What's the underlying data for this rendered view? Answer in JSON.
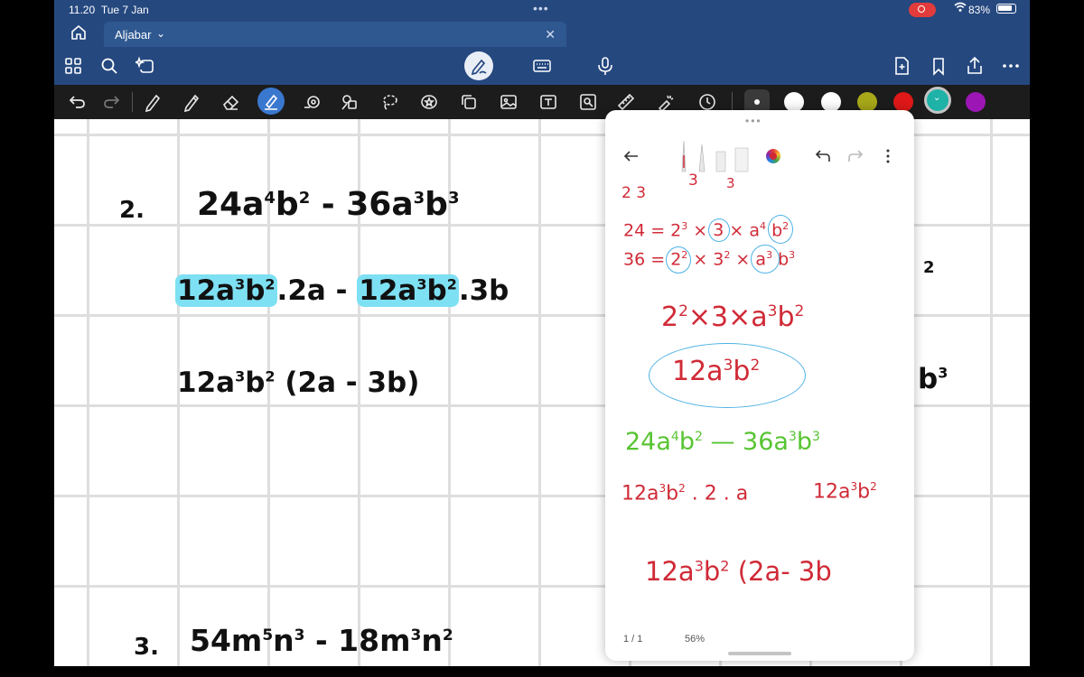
{
  "status": {
    "time": "11.20",
    "date": "Tue 7 Jan",
    "battery": "83%"
  },
  "tab": {
    "title": "Aljabar"
  },
  "colors": {
    "accent": "#25487f",
    "highlight": "#7ee0f3",
    "palette": [
      "#ffffff",
      "#ffffff",
      "#a8a81a",
      "#e01818",
      "#1fb2a7",
      "#9c16b5"
    ]
  },
  "canvas": {
    "problem2": {
      "number": "2.",
      "line1": [
        "24a",
        "4",
        "b",
        "2",
        " - 36a",
        "3",
        "b",
        "3"
      ],
      "line2": [
        "12a",
        "3",
        "b",
        "2",
        ".2a  -",
        "12a",
        "3",
        "b",
        "2",
        ".3b"
      ],
      "line3": [
        "12a",
        "3",
        "b",
        "2",
        " (2a - 3b)"
      ]
    },
    "problem3": {
      "number": "3.",
      "line1": [
        "54m",
        "5",
        "n",
        "3",
        " - 18m",
        "3",
        "n",
        "2"
      ]
    },
    "right_fragments": [
      "2",
      "b",
      "3"
    ]
  },
  "panel": {
    "top_partial": [
      "2 3",
      "3",
      "3"
    ],
    "factor1": [
      "24 = 2",
      "3",
      " ×",
      "3",
      "× a",
      "4",
      "b",
      "2"
    ],
    "factor2": [
      "36 = ",
      "2",
      "2",
      " × 3",
      "2",
      " ×",
      "a",
      "3",
      "b",
      "3"
    ],
    "gcf": [
      "2",
      "2",
      "×3×a",
      "3",
      "b",
      "2"
    ],
    "gcf_result": [
      "12a",
      "3",
      "b",
      "2"
    ],
    "green_expr": [
      "24a",
      "4",
      "b",
      "2",
      " — 36a",
      "3",
      "b",
      "3"
    ],
    "split_left": [
      "12a",
      "3",
      "b",
      "2",
      " . 2 . a"
    ],
    "split_right": [
      "12a",
      "3",
      "b",
      "2"
    ],
    "final": [
      "12a",
      "3",
      "b",
      "2",
      " (2a- 3b"
    ],
    "page_indicator": "1 / 1",
    "zoom": "56%"
  }
}
